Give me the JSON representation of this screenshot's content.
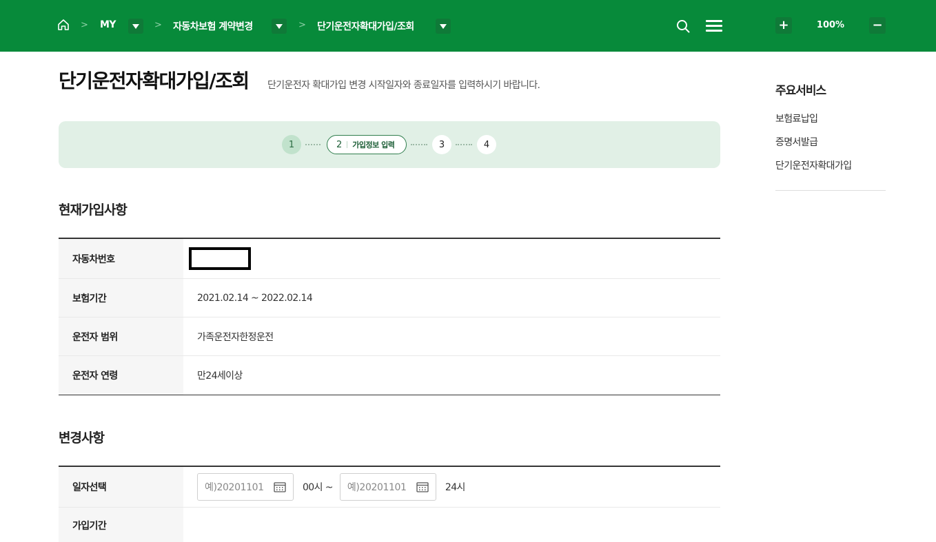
{
  "header": {
    "breadcrumb": [
      {
        "label": "MY"
      },
      {
        "label": "자동차보험 계약변경"
      },
      {
        "label": "단기운전자확대가입/조회"
      }
    ],
    "separator": ">",
    "zoom": {
      "plus": "+",
      "level": "100%",
      "minus": "−"
    }
  },
  "page": {
    "title": "단기운전자확대가입/조회",
    "description": "단기운전자 확대가입 변경 시작일자와 종료일자를 입력하시기 바랍니다."
  },
  "steps": {
    "items": [
      {
        "num": "1",
        "state": "done"
      },
      {
        "num": "2",
        "state": "current",
        "label": "가입정보 입력"
      },
      {
        "num": "3",
        "state": "todo"
      },
      {
        "num": "4",
        "state": "todo"
      }
    ]
  },
  "current_section": {
    "title": "현재가입사항",
    "rows": [
      {
        "label": "자동차번호",
        "value": ""
      },
      {
        "label": "보험기간",
        "value": "2021.02.14 ~ 2022.02.14"
      },
      {
        "label": "운전자 범위",
        "value": "가족운전자한정운전"
      },
      {
        "label": "운전자 연령",
        "value": "만24세이상"
      }
    ]
  },
  "change_section": {
    "title": "변경사항",
    "date_label": "일자선택",
    "start_placeholder": "예)20201101",
    "start_time": "00시 ~",
    "end_placeholder": "예)20201101",
    "end_time": "24시",
    "period_label": "가입기간"
  },
  "sidebar": {
    "title": "주요서비스",
    "items": [
      "보험료납입",
      "증명서발급",
      "단기운전자확대가입"
    ]
  },
  "colors": {
    "brand_green": "#078a3a",
    "step_bg": "#e1f0e6"
  }
}
